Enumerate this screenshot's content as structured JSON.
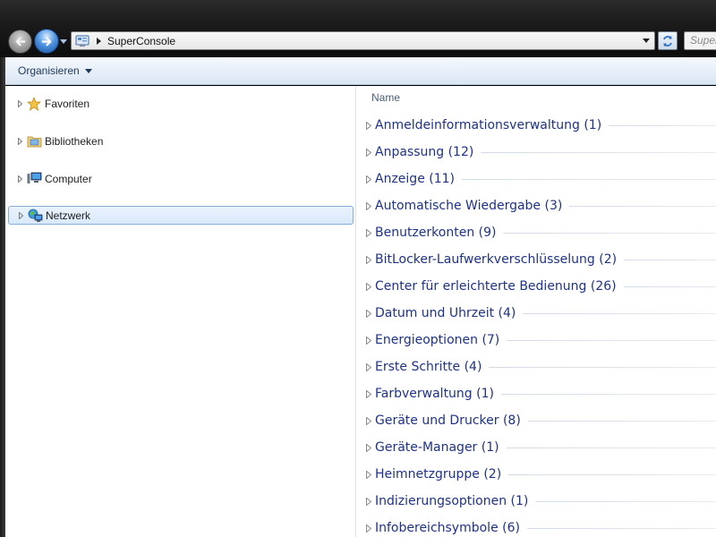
{
  "address": {
    "location_icon": "control-panel-icon",
    "path": "SuperConsole"
  },
  "search": {
    "placeholder": "SuperConsole durchsuchen"
  },
  "toolbar": {
    "organize_label": "Organisieren"
  },
  "navigation": [
    {
      "label": "Favoriten",
      "icon": "star-icon"
    },
    {
      "label": "Bibliotheken",
      "icon": "libraries-icon"
    },
    {
      "label": "Computer",
      "icon": "computer-icon"
    },
    {
      "label": "Netzwerk",
      "icon": "network-icon",
      "selected": true
    }
  ],
  "content": {
    "column_header": "Name",
    "groups": [
      "Anmeldeinformationsverwaltung (1)",
      "Anpassung (12)",
      "Anzeige (11)",
      "Automatische Wiedergabe (3)",
      "Benutzerkonten (9)",
      "BitLocker-Laufwerkverschlüsselung (2)",
      "Center für erleichterte Bedienung (26)",
      "Datum und Uhrzeit (4)",
      "Energieoptionen (7)",
      "Erste Schritte (4)",
      "Farbverwaltung (1)",
      "Geräte und Drucker (8)",
      "Geräte-Manager (1)",
      "Heimnetzgruppe (2)",
      "Indizierungsoptionen (1)",
      "Infobereichsymbole (6)"
    ]
  },
  "colors": {
    "group_text": "#1e3287",
    "selection_border": "#84acdd",
    "toolbar_bg": "#e6eef8"
  }
}
